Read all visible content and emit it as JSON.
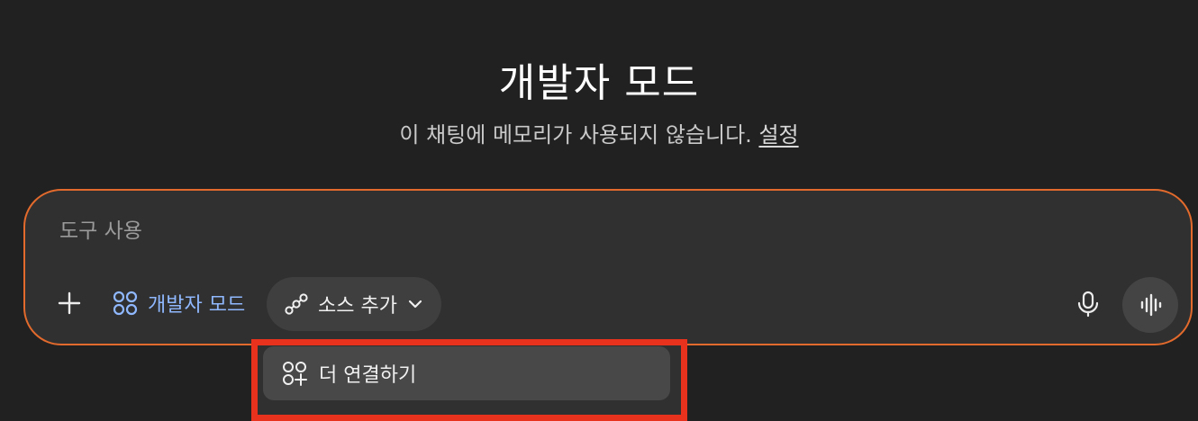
{
  "header": {
    "title": "개발자 모드",
    "subtitle_text": "이 채팅에 메모리가 사용되지 않습니다. ",
    "settings_link": "설정"
  },
  "composer": {
    "placeholder": "도구 사용",
    "add_icon": "plus-icon",
    "dev_mode_label": "개발자 모드",
    "dev_mode_icon": "apps-icon",
    "source_label": "소스 추가",
    "source_icon": "connection-icon",
    "source_chevron_icon": "chevron-down-icon",
    "mic_icon": "microphone-icon",
    "voice_icon": "voice-waveform-icon",
    "accent_color": "#e26a2c",
    "dev_mode_color": "#8fb8ff"
  },
  "dropdown": {
    "items": [
      {
        "label": "더 연결하기",
        "icon": "add-apps-icon"
      }
    ],
    "highlight_color": "#e8321e"
  }
}
